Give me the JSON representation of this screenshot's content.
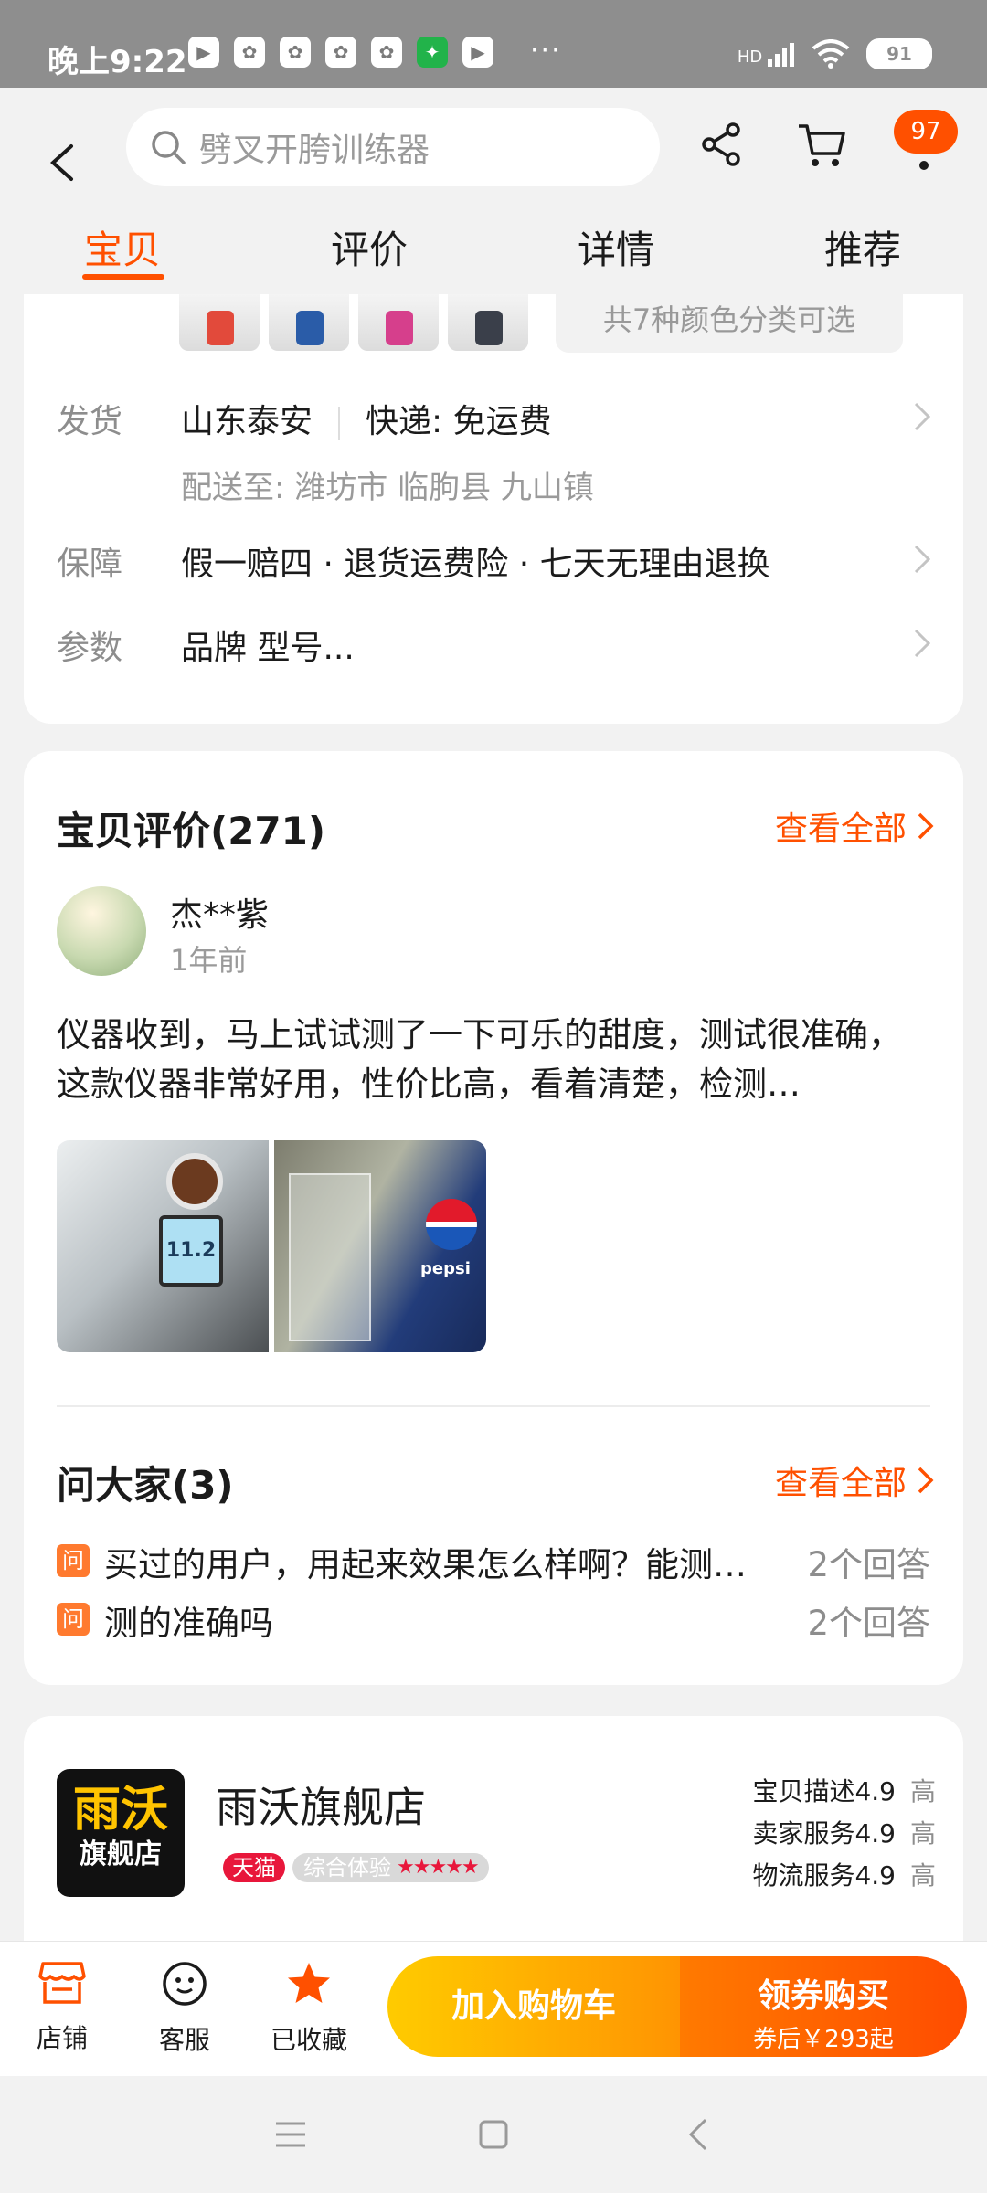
{
  "status_bar": {
    "time": "晚上9:22",
    "network": "HD",
    "battery": "91",
    "more": "···"
  },
  "header": {
    "search_placeholder": "劈叉开胯训练器",
    "cart_badge": "97"
  },
  "tabs": [
    "宝贝",
    "评价",
    "详情",
    "推荐"
  ],
  "sku": {
    "color_note": "共7种颜色分类可选"
  },
  "shipping": {
    "label": "发货",
    "origin": "山东泰安",
    "express": "快递: 免运费",
    "deliver_to": "配送至: 潍坊市 临朐县 九山镇"
  },
  "guarantee": {
    "label": "保障",
    "text": "假一赔四 · 退货运费险 · 七天无理由退换"
  },
  "params": {
    "label": "参数",
    "text": "品牌 型号..."
  },
  "reviews": {
    "title": "宝贝评价(271)",
    "see_all": "查看全部",
    "user": "杰**紫",
    "time": "1年前",
    "content": "仪器收到，马上试试测了一下可乐的甜度，测试很准确，这款仪器非常好用，性价比高，看着清楚，检测…",
    "image1_display": "11.2",
    "image2_label": "pepsi"
  },
  "qa": {
    "title": "问大家(3)",
    "see_all": "查看全部",
    "icon_text": "问",
    "items": [
      {
        "q": "买过的用户，用起来效果怎么样啊？能测…",
        "answers": "2个回答"
      },
      {
        "q": "测的准确吗",
        "answers": "2个回答"
      }
    ]
  },
  "shop": {
    "logo_top": "雨沃",
    "logo_bottom": "旗舰店",
    "name": "雨沃旗舰店",
    "tmall": "天猫",
    "overall_label": "综合体验",
    "overall_stars": "★★★★★",
    "scores": [
      {
        "label": "宝贝描述",
        "value": "4.9",
        "level": "高"
      },
      {
        "label": "卖家服务",
        "value": "4.9",
        "level": "高"
      },
      {
        "label": "物流服务",
        "value": "4.9",
        "level": "高"
      }
    ]
  },
  "bottom_bar": {
    "store": "店铺",
    "service": "客服",
    "favorite": "已收藏",
    "add_to_cart": "加入购物车",
    "buy": "领券购买",
    "buy_price": "券后￥293起"
  },
  "colors": {
    "accent": "#ff5000",
    "cart_gradient_start": "#ffcb00",
    "buy_gradient_end": "#ff4c00",
    "tmall_red": "#e8173b"
  }
}
